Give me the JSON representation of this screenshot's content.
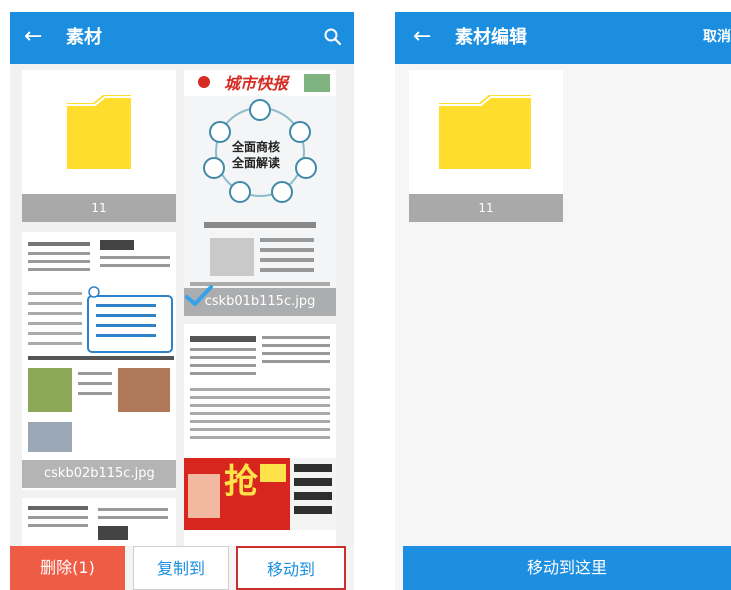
{
  "colors": {
    "appbar": "#1b8ee0",
    "delete": "#ef5c45",
    "accent": "#1b8ee0",
    "highlight_border": "#c8302c",
    "folder": "#fedd2c"
  },
  "left_screen": {
    "title": "素材",
    "back_icon": "arrow-left-icon",
    "search_icon": "search-icon",
    "folder": {
      "name": "11"
    },
    "images": [
      {
        "filename": "cskb01b115c.jpg",
        "selected": true,
        "masthead": "城市快报",
        "headline1": "全面商核",
        "headline2": "全面解读"
      },
      {
        "filename": "cskb02b115c.jpg",
        "selected": false
      },
      {
        "filename": "",
        "selected": false,
        "promo": "抢"
      },
      {
        "filename": "",
        "selected": false
      }
    ],
    "bottom_bar": {
      "delete_label": "删除(1)",
      "copy_label": "复制到",
      "move_label": "移动到"
    }
  },
  "right_screen": {
    "title": "素材编辑",
    "back_icon": "arrow-left-icon",
    "cancel_label": "取消",
    "folder": {
      "name": "11"
    },
    "move_here_label": "移动到这里"
  }
}
